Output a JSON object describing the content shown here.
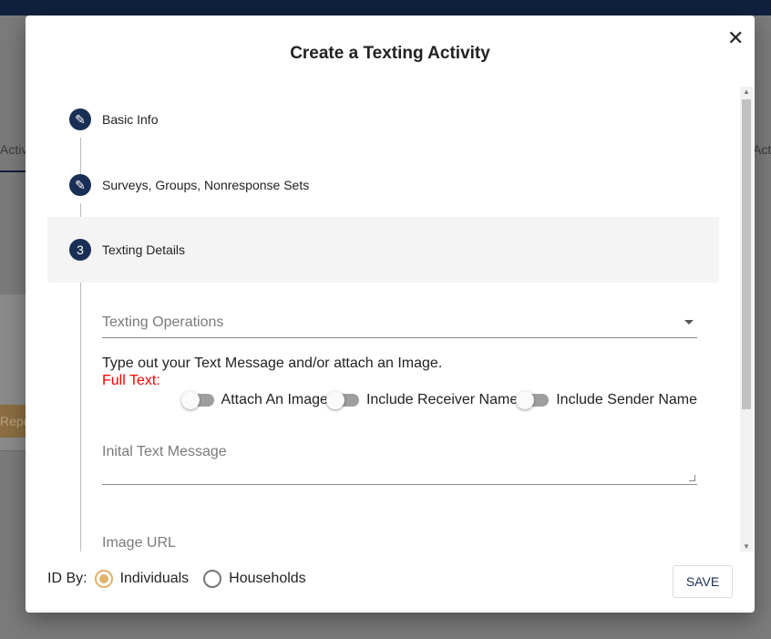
{
  "background": {
    "left_tab": "Activ",
    "right_tab": "Act",
    "left_button": "Repo"
  },
  "modal": {
    "title": "Create a Texting Activity",
    "close_icon": "close-icon",
    "steps": [
      {
        "marker": "pencil-icon",
        "label": "Basic Info"
      },
      {
        "marker": "pencil-icon",
        "label": "Surveys, Groups, Nonresponse Sets"
      },
      {
        "marker": "3",
        "label": "Texting Details"
      }
    ],
    "texting_operations": {
      "placeholder": "Texting Operations"
    },
    "instruction": "Type out your Text Message and/or attach an Image.",
    "full_text_label": "Full Text:",
    "toggles": [
      {
        "label": "Attach An Image",
        "on": false
      },
      {
        "label": "Include Receiver Name",
        "on": false
      },
      {
        "label": "Include Sender Name",
        "on": false
      }
    ],
    "initial_text": {
      "placeholder": "Inital Text Message"
    },
    "image_url": {
      "placeholder": "Image URL"
    },
    "id_by": {
      "label": "ID By:",
      "options": [
        "Individuals",
        "Households"
      ],
      "selected": "Individuals"
    },
    "save_label": "SAVE"
  },
  "colors": {
    "primary": "#1a2f55",
    "radio_accent": "#e0b26a",
    "error": "#ff0000"
  }
}
